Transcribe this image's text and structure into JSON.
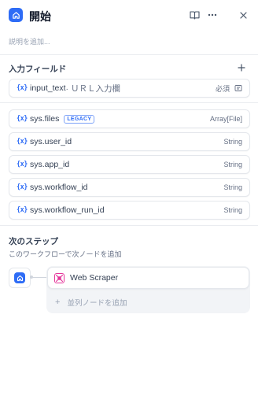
{
  "header": {
    "title": "開始",
    "start_icon": "home-icon",
    "actions": [
      "book-open-icon",
      "more-icon",
      "close-icon"
    ]
  },
  "description_placeholder": "説明を追加...",
  "input_fields": {
    "title": "入力フィールド",
    "add_icon": "plus-icon",
    "items": [
      {
        "symbol": "{x}",
        "name": "input_text",
        "label": " · ＵＲＬ入力欄",
        "required": "必須",
        "edit_icon": "edit-icon"
      }
    ]
  },
  "system_vars": [
    {
      "symbol": "{x}",
      "name": "sys.files",
      "badge": "LEGACY",
      "type": "Array[File]"
    },
    {
      "symbol": "{x}",
      "name": "sys.user_id",
      "type": "String"
    },
    {
      "symbol": "{x}",
      "name": "sys.app_id",
      "type": "String"
    },
    {
      "symbol": "{x}",
      "name": "sys.workflow_id",
      "type": "String"
    },
    {
      "symbol": "{x}",
      "name": "sys.workflow_run_id",
      "type": "String"
    }
  ],
  "next_step": {
    "title": "次のステップ",
    "subtitle": "このワークフローで次ノードを追加",
    "node_label": "Web Scraper",
    "node_icon": "web-scraper-icon",
    "add_parallel": "並列ノードを追加"
  },
  "colors": {
    "accent": "#2e6cf6",
    "web_scraper": "#e5359b"
  }
}
